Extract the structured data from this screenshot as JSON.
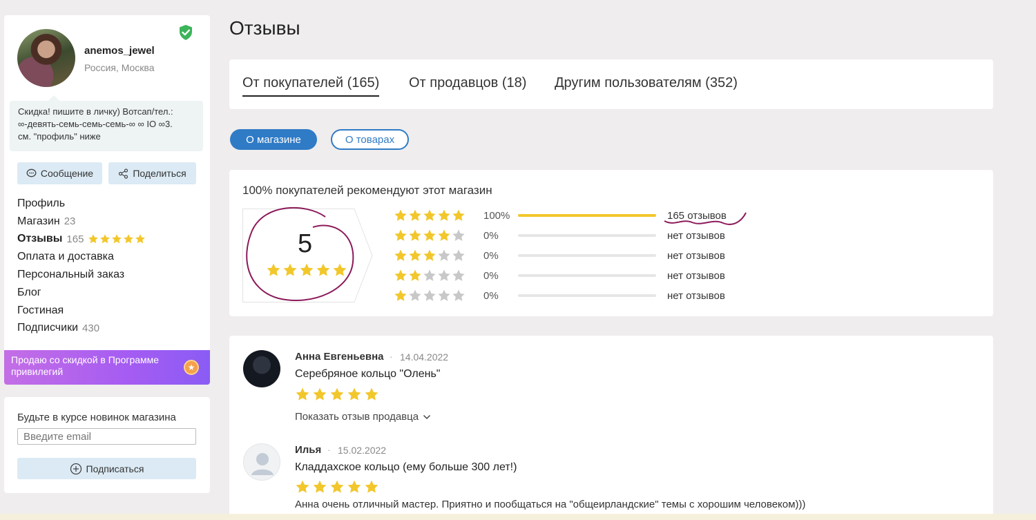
{
  "profile": {
    "username": "anemos_jewel",
    "location": "Россия, Москва",
    "status_line1": "Скидка! пишите в личку) Вотсап/тел.:",
    "status_line2": "∞-девять-семь-семь-семь-∞ ∞ IO ∞3.",
    "status_line3": "см. \"профиль\" ниже",
    "message_button": "Сообщение",
    "share_button": "Поделиться"
  },
  "sidebar_nav": [
    {
      "label": "Профиль",
      "count": ""
    },
    {
      "label": "Магазин",
      "count": "23"
    },
    {
      "label": "Отзывы",
      "count": "165"
    },
    {
      "label": "Оплата и доставка",
      "count": ""
    },
    {
      "label": "Персональный заказ",
      "count": ""
    },
    {
      "label": "Блог",
      "count": ""
    },
    {
      "label": "Гостиная",
      "count": ""
    },
    {
      "label": "Подписчики",
      "count": "430"
    }
  ],
  "promo": {
    "line1": "Продаю со скидкой в Программе",
    "line2": "привилегий"
  },
  "subscribe": {
    "title": "Будьте в курсе новинок магазина",
    "email_placeholder": "Введите email",
    "button": "Подписаться"
  },
  "page_title": "Отзывы",
  "tabs": [
    {
      "label": "От покупателей (165)",
      "active": true
    },
    {
      "label": "От продавцов (18)",
      "active": false
    },
    {
      "label": "Другим пользователям (352)",
      "active": false
    }
  ],
  "filters": {
    "shop": "О магазине",
    "items": "О товарах"
  },
  "rating": {
    "recommend_text": "100% покупателей рекомендуют этот магазин",
    "score": "5",
    "score_stars": 5,
    "distribution": [
      {
        "stars": 5,
        "percent": "100%",
        "fraction": 1.0,
        "label": "165 отзывов"
      },
      {
        "stars": 4,
        "percent": "0%",
        "fraction": 0.0,
        "label": "нет отзывов"
      },
      {
        "stars": 3,
        "percent": "0%",
        "fraction": 0.0,
        "label": "нет отзывов"
      },
      {
        "stars": 2,
        "percent": "0%",
        "fraction": 0.0,
        "label": "нет отзывов"
      },
      {
        "stars": 1,
        "percent": "0%",
        "fraction": 0.0,
        "label": "нет отзывов"
      }
    ]
  },
  "reviews": [
    {
      "name": "Анна Евгеньевна",
      "date": "14.04.2022",
      "product": "Серебряное кольцо \"Олень\"",
      "stars": 5,
      "more": "Показать отзыв продавца",
      "text": ""
    },
    {
      "name": "Илья",
      "date": "15.02.2022",
      "product": "Кладдахское кольцо (ему больше 300 лет!)",
      "stars": 5,
      "more": "",
      "text": "Анна очень отличный мастер. Приятно и пообщаться на \"общеирландские\" темы с хорошим человеком)))"
    }
  ],
  "colors": {
    "accent": "#2f7bc6",
    "star": "#f2c72c",
    "star_empty": "#c8c8c8",
    "annotation": "#8b1a5a"
  }
}
